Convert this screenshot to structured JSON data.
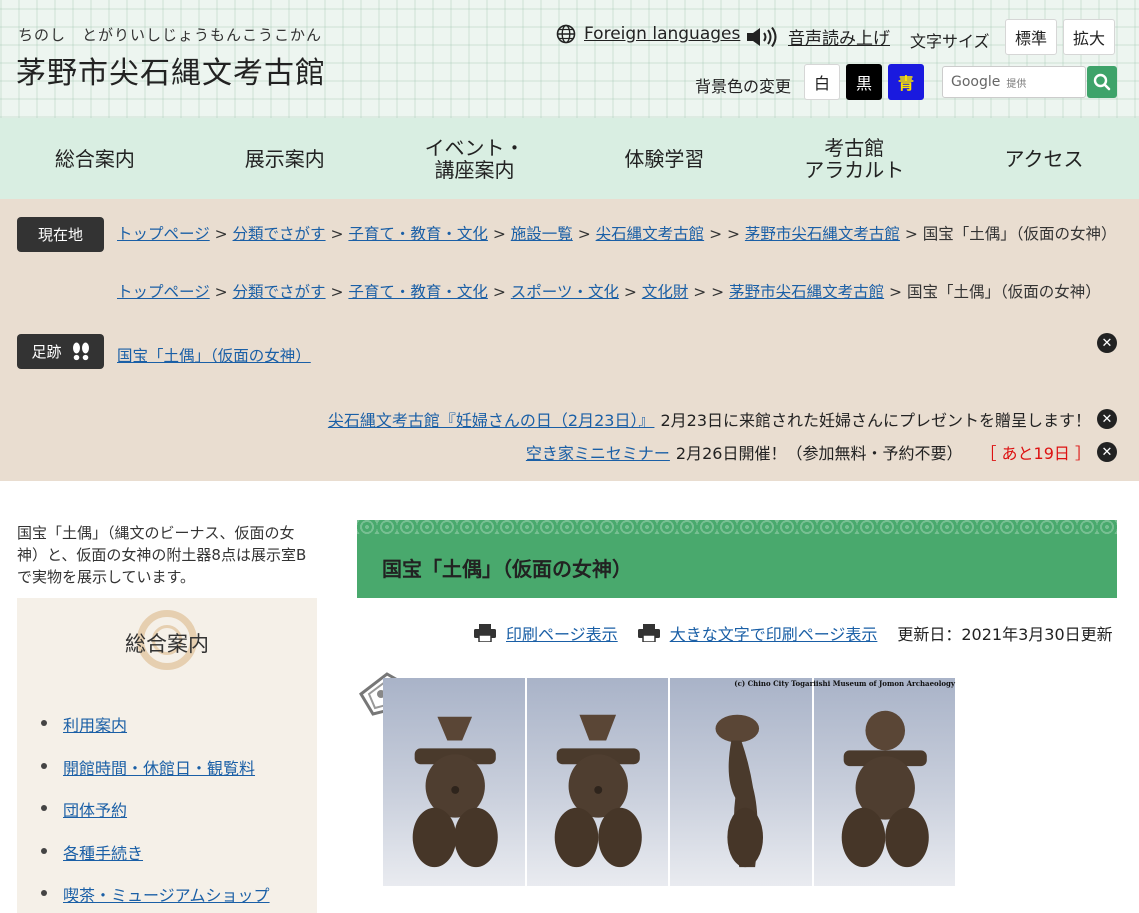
{
  "header": {
    "ruby": "ちのし　とがりいしじょうもんこうこかん",
    "title": "茅野市尖石縄文考古館",
    "foreign_languages": "Foreign languages",
    "voice": "音声読み上げ",
    "font_size_label": "文字サイズ",
    "font_std": "標準",
    "font_large": "拡大",
    "bg_label": "背景色の変更",
    "bg_white": "白",
    "bg_black": "黒",
    "bg_blue": "青",
    "search_google": "Google",
    "search_provided": "提供"
  },
  "nav": [
    {
      "label": "総合案内"
    },
    {
      "label": "展示案内"
    },
    {
      "label": "イベント・\n講座案内"
    },
    {
      "label": "体験学習"
    },
    {
      "label": "考古館\nアラカルト"
    },
    {
      "label": "アクセス"
    }
  ],
  "breadcrumb": {
    "here_label": "現在地",
    "path1": [
      {
        "text": "トップページ",
        "link": true
      },
      {
        "text": "分類でさがす",
        "link": true
      },
      {
        "text": "子育て・教育・文化",
        "link": true
      },
      {
        "text": "施設一覧",
        "link": true
      },
      {
        "text": "尖石縄文考古館",
        "link": true
      },
      {
        "text": "",
        "link": false
      },
      {
        "text": "茅野市尖石縄文考古館",
        "link": true
      },
      {
        "text": "国宝「土偶」（仮面の女神）",
        "link": false
      }
    ],
    "path2": [
      {
        "text": "トップページ",
        "link": true
      },
      {
        "text": "分類でさがす",
        "link": true
      },
      {
        "text": "子育て・教育・文化",
        "link": true
      },
      {
        "text": "スポーツ・文化",
        "link": true
      },
      {
        "text": "文化財",
        "link": true
      },
      {
        "text": "",
        "link": false
      },
      {
        "text": "茅野市尖石縄文考古館",
        "link": true
      },
      {
        "text": "国宝「土偶」（仮面の女神）",
        "link": false
      }
    ],
    "footprint_label": "足跡",
    "footprint_link": "国宝「土偶」（仮面の女神）"
  },
  "notices": [
    {
      "link": "尖石縄文考古館『妊婦さんの日（2月23日）』",
      "text": "2月23日に来館された妊婦さんにプレゼントを贈呈します！",
      "remain": ""
    },
    {
      "link": "空き家ミニセミナー",
      "text": "2月26日開催！（参加無料・予約不要）",
      "remain": "［ あと19日 ］"
    }
  ],
  "sidebar": {
    "intro": "国宝「土偶」（縄文のビーナス、仮面の女神）と、仮面の女神の附土器8点は展示室Bで実物を展示しています。",
    "title": "総合案内",
    "items": [
      {
        "label": "利用案内"
      },
      {
        "label": "開館時間・休館日・観覧料"
      },
      {
        "label": "団体予約"
      },
      {
        "label": "各種手続き"
      },
      {
        "label": "喫茶・ミュージアムショップ"
      }
    ]
  },
  "main": {
    "heading": "国宝「土偶」（仮面の女神）",
    "print": "印刷ページ表示",
    "print_large": "大きな文字で印刷ページ表示",
    "updated": "更新日：2021年3月30日更新",
    "photo_credit": "(c) Chino City Togariishi Museum of Jomon Archaeology"
  },
  "colors": {
    "nav_bg": "#d9eee2",
    "crumb_bg": "#e9ddd0",
    "heading_bg": "#49a96d",
    "link": "#1a5fa6",
    "remain": "#dd1111"
  }
}
